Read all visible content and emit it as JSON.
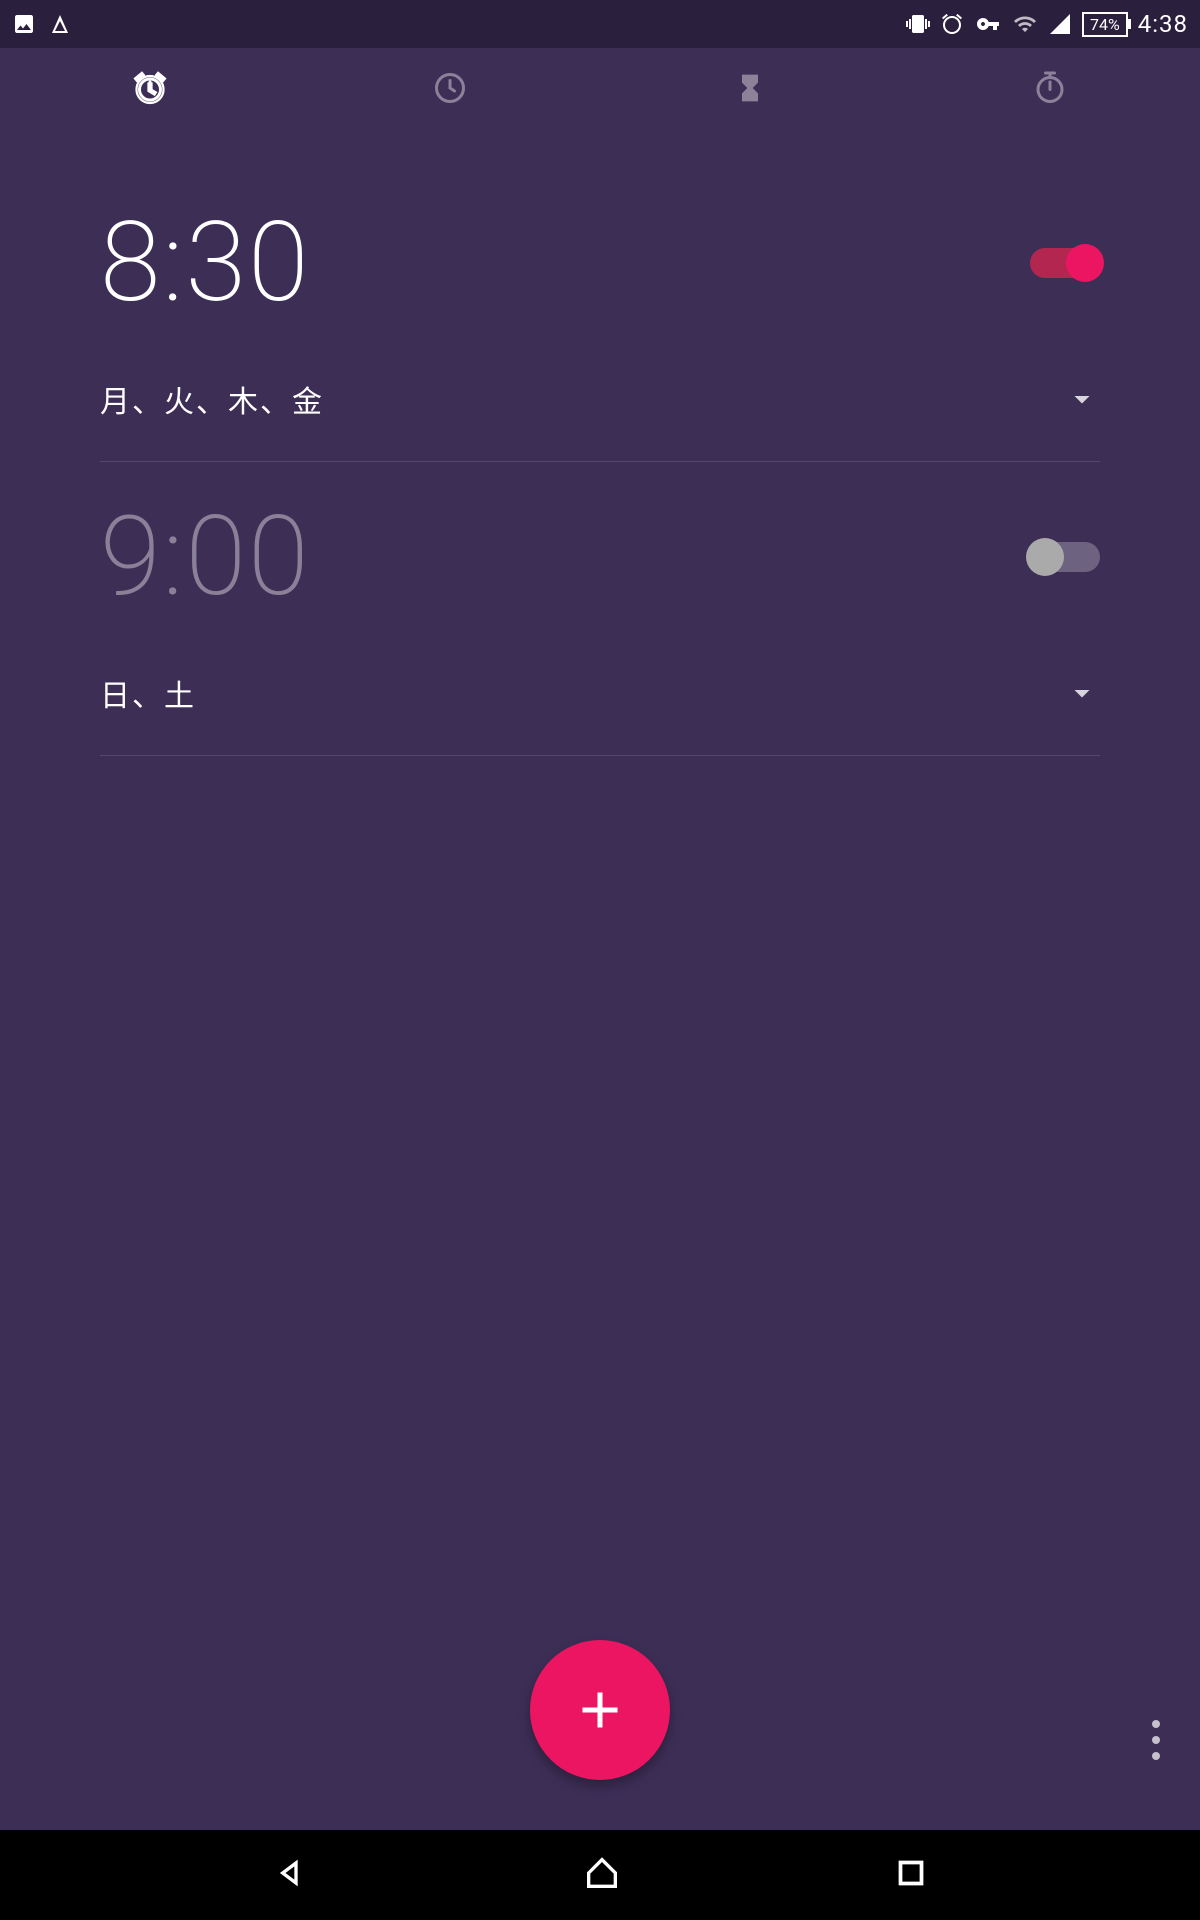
{
  "status": {
    "battery": "74%",
    "time": "4:38"
  },
  "tabs": [
    {
      "name": "alarm",
      "active": true
    },
    {
      "name": "clock",
      "active": false
    },
    {
      "name": "timer",
      "active": false
    },
    {
      "name": "stopwatch",
      "active": false
    }
  ],
  "alarms": [
    {
      "time": "8:30",
      "days": "月、火、木、金",
      "enabled": true
    },
    {
      "time": "9:00",
      "days": "日、土",
      "enabled": false
    }
  ]
}
